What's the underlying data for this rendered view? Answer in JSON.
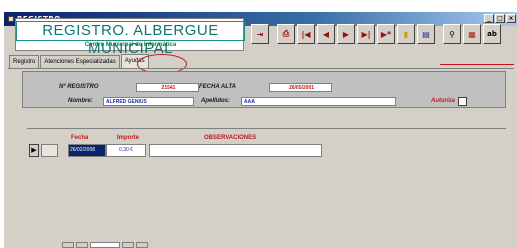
{
  "window": {
    "title": "REGISTRO",
    "controls": [
      "_",
      "□",
      "×"
    ]
  },
  "header": {
    "title": "REGISTRO. ALBERGUE MUNICIPAL",
    "subtitle": "Centro Municipal de Informática"
  },
  "toolbar": {
    "buttons": [
      {
        "icon": "exit-icon",
        "glyph": "⇥"
      },
      {
        "icon": "print-icon",
        "glyph": "⎙"
      },
      {
        "icon": "first-record-icon",
        "glyph": "|◀"
      },
      {
        "icon": "previous-record-icon",
        "glyph": "◀"
      },
      {
        "icon": "next-record-icon",
        "glyph": "▶"
      },
      {
        "icon": "last-record-icon",
        "glyph": "▶|"
      },
      {
        "icon": "new-record-icon",
        "glyph": "▶*"
      },
      {
        "icon": "delete-record-icon",
        "glyph": "▮"
      },
      {
        "icon": "save-record-icon",
        "glyph": "▤"
      },
      {
        "icon": "binoculars-icon",
        "glyph": "⚲"
      },
      {
        "icon": "report-icon",
        "glyph": "▦"
      },
      {
        "icon": "spellcheck-icon",
        "glyph": "ab"
      }
    ]
  },
  "tabs": [
    {
      "label": "Registro"
    },
    {
      "label": "Atenciones Especializadas"
    },
    {
      "label": "Ayudas"
    }
  ],
  "form": {
    "registro_label": "Nº REGISTRO",
    "registro_value": "21541",
    "fecha_alta_label": "FECHA ALTA",
    "fecha_alta_value": "26/05/2001",
    "nombre_label": "Nombre:",
    "nombre_value": "ALFRED GENIUS",
    "apellidos_label": "Apellidos:",
    "apellidos_value": "AAA",
    "autoriza_label": "Autoriza"
  },
  "ayudas": {
    "columns": {
      "fecha": "Fecha",
      "importe": "Importe",
      "observaciones": "OBSERVACIONES"
    },
    "rows": [
      {
        "selector": "▶",
        "fecha": "26/02/2008",
        "importe": "0,30 €",
        "observaciones": ""
      }
    ]
  }
}
